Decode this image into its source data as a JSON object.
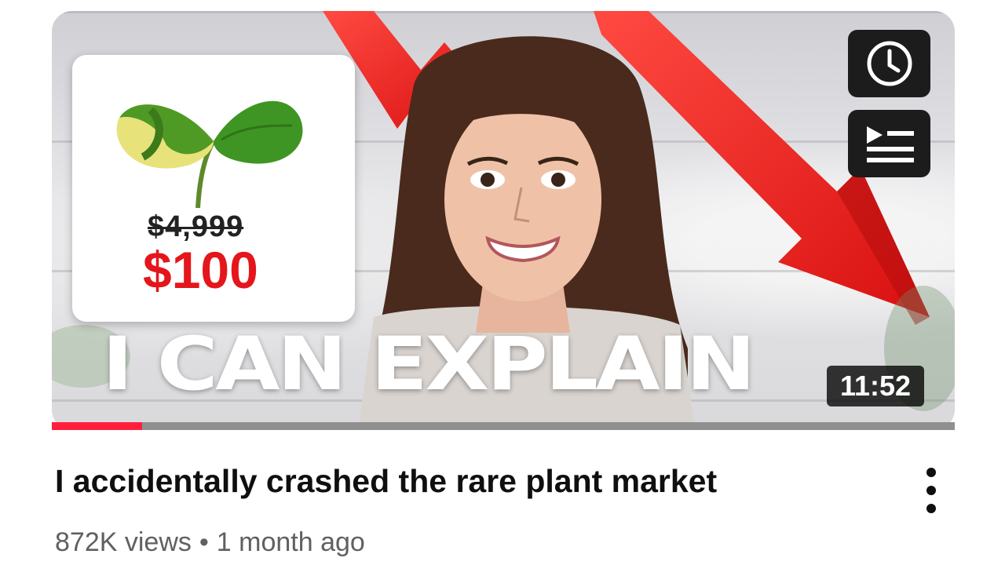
{
  "thumbnail": {
    "old_price": "$4,999",
    "new_price": "$100",
    "caption": "I CAN EXPLAIN",
    "duration": "11:52",
    "watch_later_icon": "clock-icon",
    "add_to_queue_icon": "queue-icon",
    "watch_progress_fraction": 0.1,
    "accent_red": "#e5161b",
    "progress_color": "#ff1f3d"
  },
  "video": {
    "title": "I accidentally crashed the rare plant market",
    "views": "872K views",
    "separator": "•",
    "age": "1 month ago",
    "more_icon": "more-vertical-icon"
  }
}
